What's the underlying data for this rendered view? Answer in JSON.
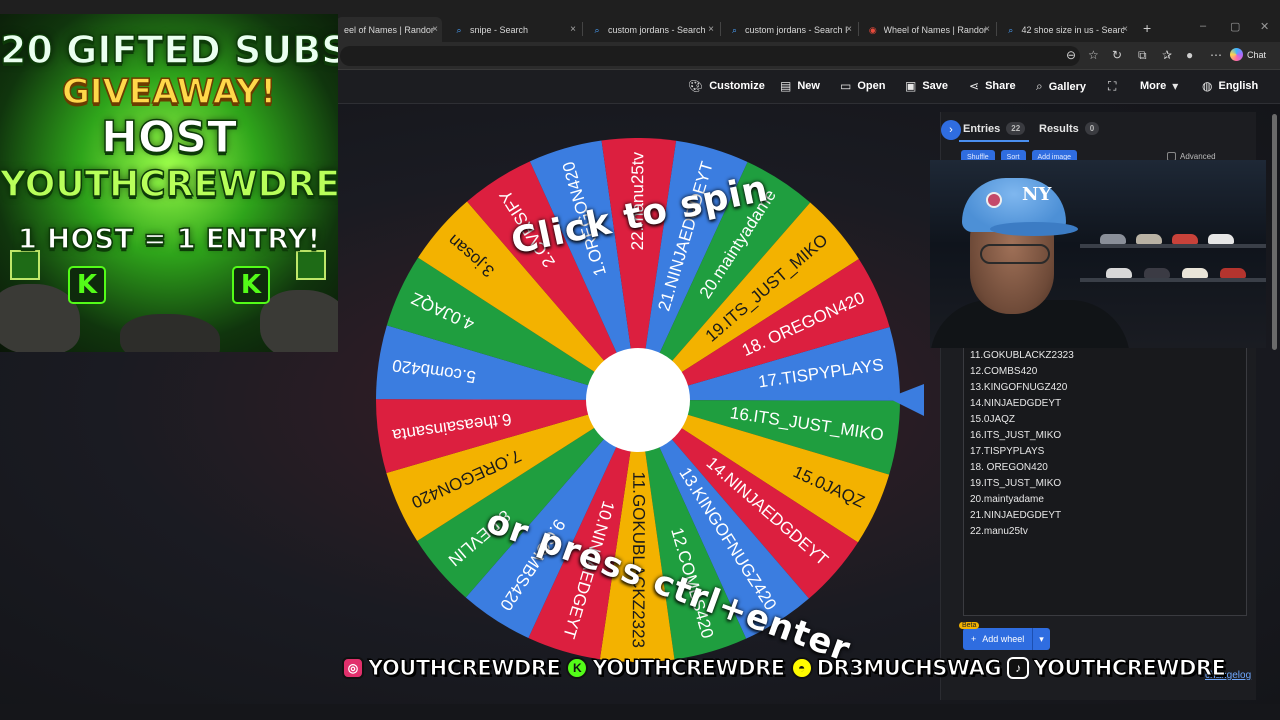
{
  "browser": {
    "tabs": [
      {
        "title": "eel of Names | Random",
        "icon": "wheel-icon",
        "active": true
      },
      {
        "title": "snipe - Search",
        "icon": "search-icon",
        "active": false
      },
      {
        "title": "custom jordans - Search",
        "icon": "search-icon",
        "active": false
      },
      {
        "title": "custom jordans - Search Ima",
        "icon": "search-icon",
        "active": false
      },
      {
        "title": "Wheel of Names | Random",
        "icon": "wheel-icon",
        "active": false
      },
      {
        "title": "42 shoe size in us - Search",
        "icon": "search-icon",
        "active": false
      }
    ],
    "chat_label": "Chat"
  },
  "nav": {
    "customize": "Customize",
    "new": "New",
    "open": "Open",
    "save": "Save",
    "share": "Share",
    "gallery": "Gallery",
    "more": "More",
    "language": "English"
  },
  "wheel": {
    "prompt_line1": "Click to spin",
    "prompt_line2": "or press ctrl+enter",
    "segments": [
      {
        "label": "17.TISPYPLAYS",
        "color": "#3b7de0"
      },
      {
        "label": "16.ITS_JUST_MIKO",
        "color": "#1f9e3f"
      },
      {
        "label": "15.0JAQZ",
        "color": "#f3b200"
      },
      {
        "label": "14.NINJAEDGDEYT",
        "color": "#dc1f3f"
      },
      {
        "label": "13.KINGOFNUGZ420",
        "color": "#3b7de0"
      },
      {
        "label": "12.COMBS420",
        "color": "#1f9e3f"
      },
      {
        "label": "11.GOKUBLACKZ2323",
        "color": "#f3b200"
      },
      {
        "label": "10.NINJAEDGEYT",
        "color": "#dc1f3f"
      },
      {
        "label": "9.COMBS420",
        "color": "#3b7de0"
      },
      {
        "label": "8.DEVLIN",
        "color": "#1f9e3f"
      },
      {
        "label": "7.OREGON420",
        "color": "#f3b200"
      },
      {
        "label": "6.theasainsanta",
        "color": "#dc1f3f"
      },
      {
        "label": "5.comb420",
        "color": "#3b7de0"
      },
      {
        "label": "4.0JAQZ",
        "color": "#1f9e3f"
      },
      {
        "label": "3.josan",
        "color": "#f3b200"
      },
      {
        "label": "2.CVRSIFY",
        "color": "#dc1f3f"
      },
      {
        "label": "1.OREGON420",
        "color": "#3b7de0"
      },
      {
        "label": "22.manu25tv",
        "color": "#dc1f3f"
      },
      {
        "label": "21.NINJAEDGDEYT",
        "color": "#3b7de0"
      },
      {
        "label": "20.maintyadame",
        "color": "#1f9e3f"
      },
      {
        "label": "19.ITS_JUST_MIKO",
        "color": "#f3b200"
      },
      {
        "label": "18. OREGON420",
        "color": "#dc1f3f"
      }
    ]
  },
  "panel": {
    "entries_tab": "Entries",
    "entries_count": "22",
    "results_tab": "Results",
    "results_count": "0",
    "shuffle": "Shuffle",
    "sort": "Sort",
    "add_image": "Add image",
    "advanced": "Advanced",
    "entries": [
      "11.GOKUBLACKZ2323",
      "12.COMBS420",
      "13.KINGOFNUGZ420",
      "14.NINJAEDGDEYT",
      "15.0JAQZ",
      "16.ITS_JUST_MIKO",
      "17.TISPYPLAYS",
      "18. OREGON420",
      "19.ITS_JUST_MIKO",
      "20.maintyadame",
      "21.NINJAEDGDEYT",
      "22.manu25tv"
    ],
    "beta_badge": "Beta",
    "add_wheel": "Add wheel",
    "changelog": "changelog"
  },
  "webcam": {
    "cap_logo": "NY"
  },
  "giveaway": {
    "line1": "20 GIFTED SUBS",
    "line2": "GIVEAWAY!",
    "line3": "HOST",
    "line4": "YOUTHCREWDRE",
    "line5": "1 HOST = 1 ENTRY!",
    "logo_letter": "K"
  },
  "socials": [
    {
      "platform": "instagram-icon",
      "handle": "YOUTHCREWDRE",
      "color": "#e1306c"
    },
    {
      "platform": "kick-icon",
      "handle": "YOUTHCREWDRE",
      "color": "#53fc18"
    },
    {
      "platform": "snapchat-icon",
      "handle": "DR3MUCHSWAG",
      "color": "#fffc00"
    },
    {
      "platform": "tiktok-icon",
      "handle": "YOUTHCREWDRE",
      "color": "#111111"
    }
  ]
}
